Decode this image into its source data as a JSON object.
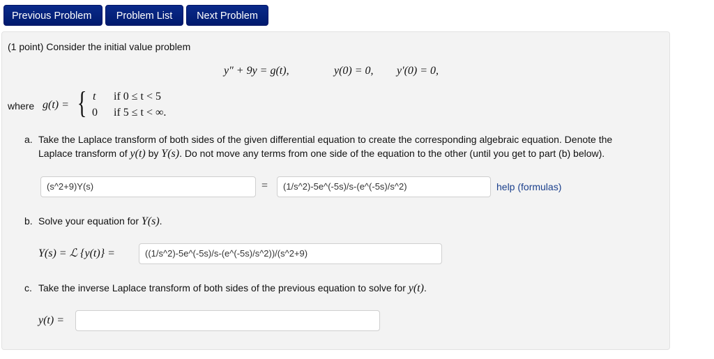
{
  "nav": {
    "previous_label": "Previous Problem",
    "list_label": "Problem List",
    "next_label": "Next Problem"
  },
  "problem": {
    "intro": "(1 point) Consider the initial value problem",
    "ode": {
      "lhs": "y″ + 9y = g(t),",
      "ic1": "y(0) = 0,",
      "ic2": "y′(0) = 0,"
    },
    "piecewise": {
      "where_label": "where",
      "func": "g(t) =",
      "case1_value": "t",
      "case1_cond": "if 0 ≤ t < 5",
      "case2_value": "0",
      "case2_cond": "if 5 ≤ t < ∞."
    },
    "part_a": {
      "marker": "a.",
      "line1": "Take the Laplace transform of both sides of the given differential equation to create the corresponding algebraic equation. Denote the",
      "line2_pre": "Laplace transform of",
      "line2_y": "y(t)",
      "line2_by": "by",
      "line2_Y": "Y(s)",
      "line2_post": ". Do not move any terms from one side of the equation to the other (until you get to part (b) below).",
      "lhs_value": "(s^2+9)Y(s)",
      "equals": "=",
      "rhs_value": "(1/s^2)-5e^(-5s)/s-(e^(-5s)/s^2)",
      "help_label": "help (formulas)"
    },
    "part_b": {
      "marker": "b.",
      "text": "Solve your equation for",
      "Y": "Y(s)",
      "period": ".",
      "label": "Y(s) = ℒ {y(t)} =",
      "value": "((1/s^2)-5e^(-5s)/s-(e^(-5s)/s^2))/(s^2+9)"
    },
    "part_c": {
      "marker": "c.",
      "text": "Take the inverse Laplace transform of both sides of the previous equation to solve for",
      "y": "y(t)",
      "period": ".",
      "label": "y(t) =",
      "value": ""
    }
  }
}
